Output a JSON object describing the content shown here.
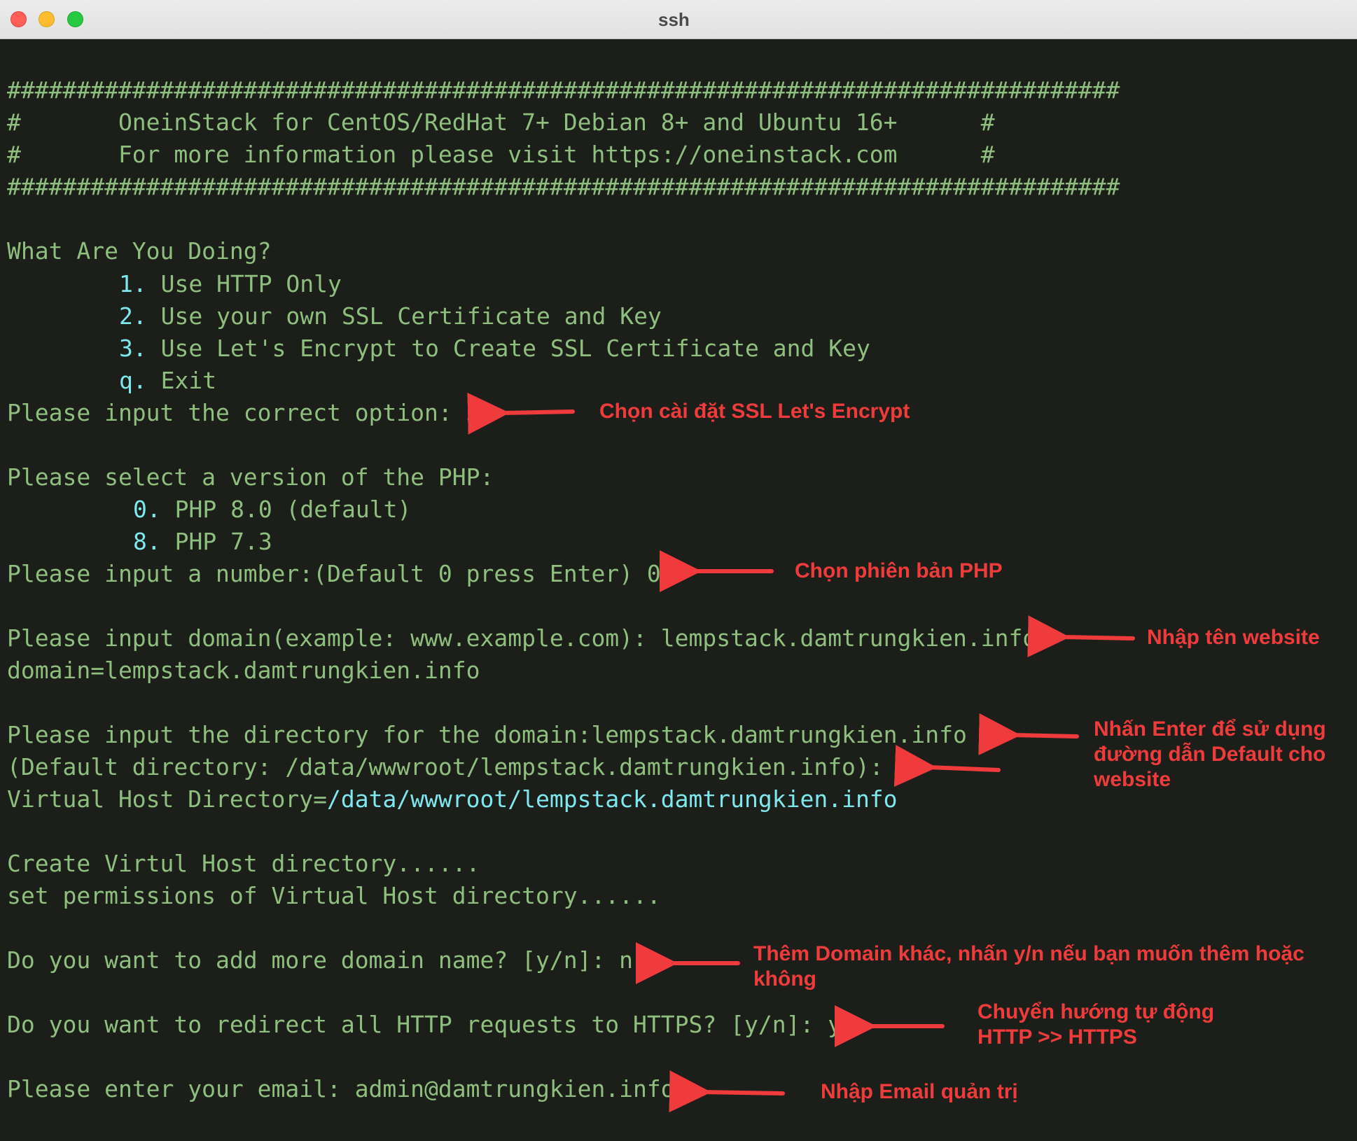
{
  "window": {
    "title": "ssh"
  },
  "terminal": {
    "lines": {
      "banner_top": "################################################################################",
      "banner_l1": "#       OneinStack for CentOS/RedHat 7+ Debian 8+ and Ubuntu 16+      #",
      "banner_l2": "#       For more information please visit https://oneinstack.com      #",
      "banner_bottom": "################################################################################",
      "question": "What Are You Doing?",
      "opt1_key": "1.",
      "opt1_text": " Use HTTP Only",
      "opt2_key": "2.",
      "opt2_text": " Use your own SSL Certificate and Key",
      "opt3_key": "3.",
      "opt3_text": " Use Let's Encrypt to Create SSL Certificate and Key",
      "optq_key": "q.",
      "optq_text": " Exit",
      "option_prompt": "Please input the correct option: 3",
      "php_prompt": "Please select a version of the PHP:",
      "php0_key": "0.",
      "php0_text": " PHP 8.0 (default)",
      "php8_key": "8.",
      "php8_text": " PHP 7.3",
      "php_input": "Please input a number:(Default 0 press Enter) 0",
      "domain_input": "Please input domain(example: www.example.com): lempstack.damtrungkien.info",
      "domain_echo": "domain=lempstack.damtrungkien.info",
      "dir_prompt": "Please input the directory for the domain:lempstack.damtrungkien.info :",
      "dir_default": "(Default directory: /data/wwwroot/lempstack.damtrungkien.info):",
      "vhost_label": "Virtual Host Directory=",
      "vhost_path": "/data/wwwroot/lempstack.damtrungkien.info",
      "create_dir": "Create Virtul Host directory......",
      "set_perm": "set permissions of Virtual Host directory......",
      "more_domain": "Do you want to add more domain name? [y/n]: n",
      "redirect": "Do you want to redirect all HTTP requests to HTTPS? [y/n]: y",
      "email": "Please enter your email: admin@damtrungkien.info"
    }
  },
  "annotations": {
    "ssl": "Chọn cài đặt SSL Let's Encrypt",
    "php": "Chọn phiên bản PHP",
    "domain": "Nhập tên website",
    "directory": "Nhấn Enter để sử dụng đường dẫn Default cho website",
    "more_domain": "Thêm Domain khác, nhấn y/n nếu bạn muốn thêm hoặc không",
    "redirect_l1": "Chuyển hướng tự động",
    "redirect_l2": "HTTP >> HTTPS",
    "email": "Nhập Email quản trị"
  },
  "colors": {
    "terminal_bg": "#1c1f19",
    "terminal_text": "#8fbf7f",
    "highlight": "#7fe7ee",
    "annotation": "#ef3b3b"
  }
}
